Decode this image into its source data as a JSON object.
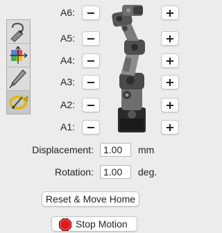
{
  "tools": [
    {
      "icon": "wrist-hook-icon",
      "selected": false
    },
    {
      "icon": "axis-frame-icon",
      "selected": false
    },
    {
      "icon": "pen-icon",
      "selected": false
    },
    {
      "icon": "circular-arrow-icon",
      "selected": true
    }
  ],
  "joints": [
    {
      "label": "A6:",
      "minus_icon": "minus-icon",
      "plus_icon": "plus-icon"
    },
    {
      "label": "A5:",
      "minus_icon": "minus-icon",
      "plus_icon": "plus-icon"
    },
    {
      "label": "A4:",
      "minus_icon": "minus-icon",
      "plus_icon": "plus-icon"
    },
    {
      "label": "A3:",
      "minus_icon": "minus-icon",
      "plus_icon": "plus-icon"
    },
    {
      "label": "A2:",
      "minus_icon": "minus-icon",
      "plus_icon": "plus-icon"
    },
    {
      "label": "A1:",
      "minus_icon": "minus-icon",
      "plus_icon": "plus-icon"
    }
  ],
  "displacement": {
    "label": "Displacement:",
    "value": "1.00",
    "unit": "mm"
  },
  "rotation": {
    "label": "Rotation:",
    "value": "1.00",
    "unit": "deg."
  },
  "reset_button": {
    "label": "Reset & Move Home"
  },
  "stop_button": {
    "label": "Stop Motion",
    "icon": "stop-sign-icon",
    "color": "#e01b1b"
  }
}
